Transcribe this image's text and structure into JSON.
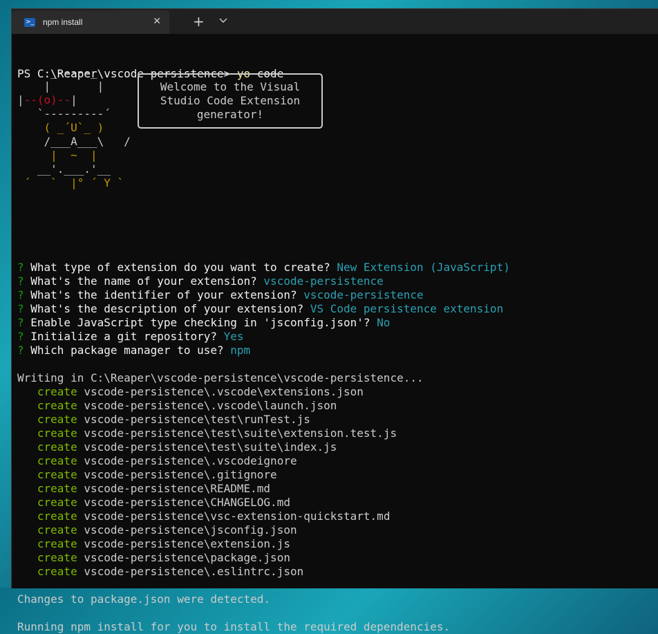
{
  "tab": {
    "title": "npm install",
    "icon": "powershell-icon",
    "close": "✕",
    "new": "+"
  },
  "prompt": {
    "ps": "PS C:\\Reaper\\vscode-persistence> ",
    "cmd": "yo",
    "arg": " code"
  },
  "bubble": {
    "line1": "Welcome to the Visual",
    "line2": "Studio Code Extension",
    "line3": "generator!"
  },
  "art": [
    "     _-----_",
    "    |       |",
    "    |--(o)--|",
    "   `---------´",
    "    ( _´U`_ )",
    "    /___A___\\   /",
    "     |  ~  |",
    "   __'.___.'__",
    " ´   `  |° ´ Y `"
  ],
  "questions": [
    {
      "q": "What type of extension do you want to create? ",
      "a": "New Extension (JavaScript)"
    },
    {
      "q": "What's the name of your extension? ",
      "a": "vscode-persistence"
    },
    {
      "q": "What's the identifier of your extension? ",
      "a": "vscode-persistence"
    },
    {
      "q": "What's the description of your extension? ",
      "a": "VS Code persistence extension"
    },
    {
      "q": "Enable JavaScript type checking in 'jsconfig.json'? ",
      "a": "No"
    },
    {
      "q": "Initialize a git repository? ",
      "a": "Yes"
    },
    {
      "q": "Which package manager to use? ",
      "a": "npm"
    }
  ],
  "writing": "Writing in C:\\Reaper\\vscode-persistence\\vscode-persistence...",
  "create_word": "create",
  "files": [
    "vscode-persistence\\.vscode\\extensions.json",
    "vscode-persistence\\.vscode\\launch.json",
    "vscode-persistence\\test\\runTest.js",
    "vscode-persistence\\test\\suite\\extension.test.js",
    "vscode-persistence\\test\\suite\\index.js",
    "vscode-persistence\\.vscodeignore",
    "vscode-persistence\\.gitignore",
    "vscode-persistence\\README.md",
    "vscode-persistence\\CHANGELOG.md",
    "vscode-persistence\\vsc-extension-quickstart.md",
    "vscode-persistence\\jsconfig.json",
    "vscode-persistence\\extension.js",
    "vscode-persistence\\package.json",
    "vscode-persistence\\.eslintrc.json"
  ],
  "changes": "Changes to package.json were detected.",
  "running": "Running npm install for you to install the required dependencies."
}
